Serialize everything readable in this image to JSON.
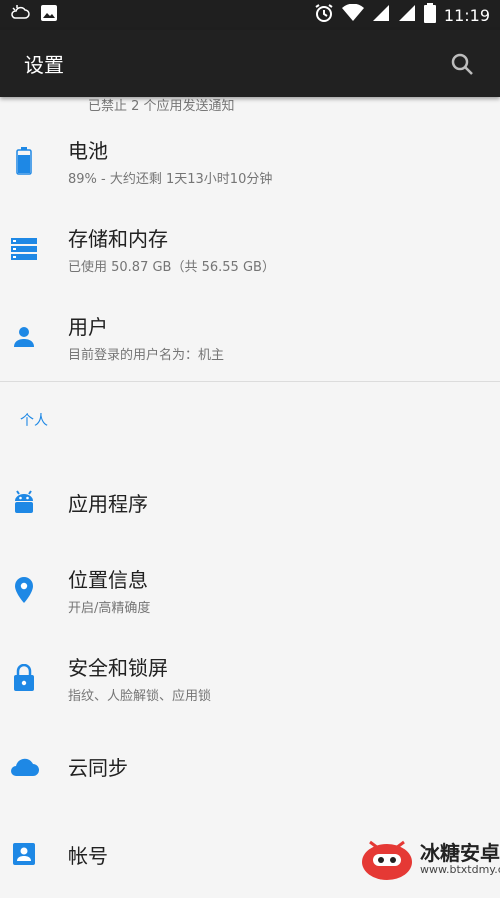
{
  "status_bar": {
    "time": "11:19",
    "icons": [
      "weather-icon",
      "image-icon",
      "alarm-icon",
      "wifi-icon",
      "signal-icon",
      "signal-icon",
      "battery-icon"
    ]
  },
  "app_bar": {
    "title": "设置",
    "search_icon": "search-icon"
  },
  "partial_item": {
    "subtitle": "已禁止 2 个应用发送通知"
  },
  "items_a": [
    {
      "label": "电池",
      "subtitle": "89% - 大约还剩 1天13小时10分钟",
      "icon": "battery-icon"
    },
    {
      "label": "存储和内存",
      "subtitle": "已使用 50.87 GB（共 56.55 GB）",
      "icon": "storage-icon"
    },
    {
      "label": "用户",
      "subtitle": "目前登录的用户名为：机主",
      "icon": "user-icon"
    }
  ],
  "section": {
    "label": "个人"
  },
  "items_b": [
    {
      "label": "应用程序",
      "subtitle": "",
      "icon": "android-icon"
    },
    {
      "label": "位置信息",
      "subtitle": "开启/高精确度",
      "icon": "location-icon"
    },
    {
      "label": "安全和锁屏",
      "subtitle": "指纹、人脸解锁、应用锁",
      "icon": "lock-icon"
    },
    {
      "label": "云同步",
      "subtitle": "",
      "icon": "cloud-icon"
    },
    {
      "label": "帐号",
      "subtitle": "",
      "icon": "account-icon"
    }
  ],
  "watermark": {
    "title": "冰糖安卓网",
    "url": "www.btxtdmy.com"
  },
  "colors": {
    "accent": "#1e88e5",
    "bar": "#212121"
  }
}
